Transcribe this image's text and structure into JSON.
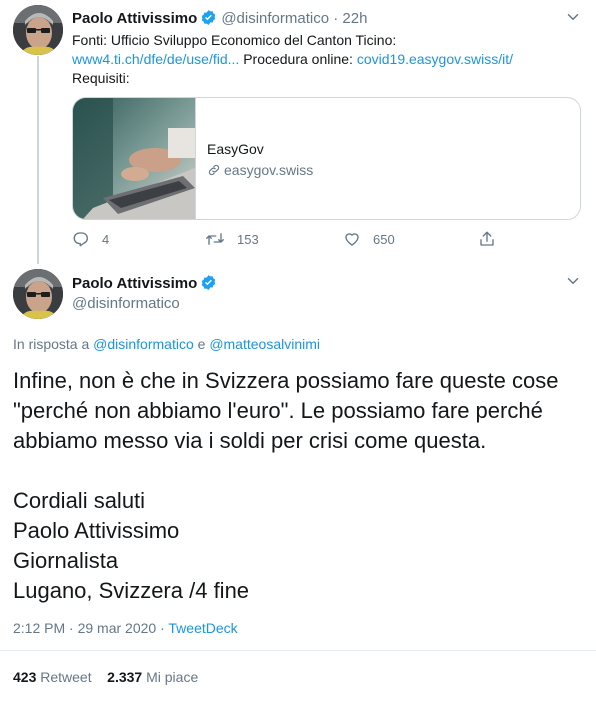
{
  "tweet1": {
    "author_name": "Paolo Attivissimo",
    "handle": "@disinformatico",
    "separator": "·",
    "time": "22h",
    "line1": "Fonti: Ufficio Sviluppo Economico del Canton Ticino:",
    "link1": "www4.ti.ch/dfe/de/use/fid...",
    "procedura_label": "Procedura online:",
    "link2": "covid19.easygov.swiss/it/",
    "line3": "Requisiti:",
    "card": {
      "title": "EasyGov",
      "url": "easygov.swiss"
    },
    "actions": {
      "replies": "4",
      "retweets": "153",
      "likes": "650"
    }
  },
  "tweet2": {
    "author_name": "Paolo Attivissimo",
    "handle": "@disinformatico",
    "reply_prefix": "In risposta a",
    "reply_user1": "@disinformatico",
    "reply_and": "e",
    "reply_user2": "@matteosalvinimi",
    "text": "Infine, non è che in Svizzera possiamo fare queste cose\n\"perché non abbiamo l'euro\". Le possiamo fare perché\nabbiamo messo via i soldi per crisi come questa.\n\nCordiali saluti\nPaolo Attivissimo\nGiornalista\nLugano, Svizzera /4 fine",
    "timestamp": "2:12 PM · 29 mar 2020",
    "timestamp_sep": "·",
    "source": "TweetDeck",
    "retweet_count": "423",
    "retweet_label": "Retweet",
    "like_count": "2.337",
    "like_label": "Mi piace"
  },
  "colors": {
    "accent": "#1b95e0",
    "verified": "#1da1f2",
    "muted": "#657786",
    "border": "#ccd6dd"
  }
}
